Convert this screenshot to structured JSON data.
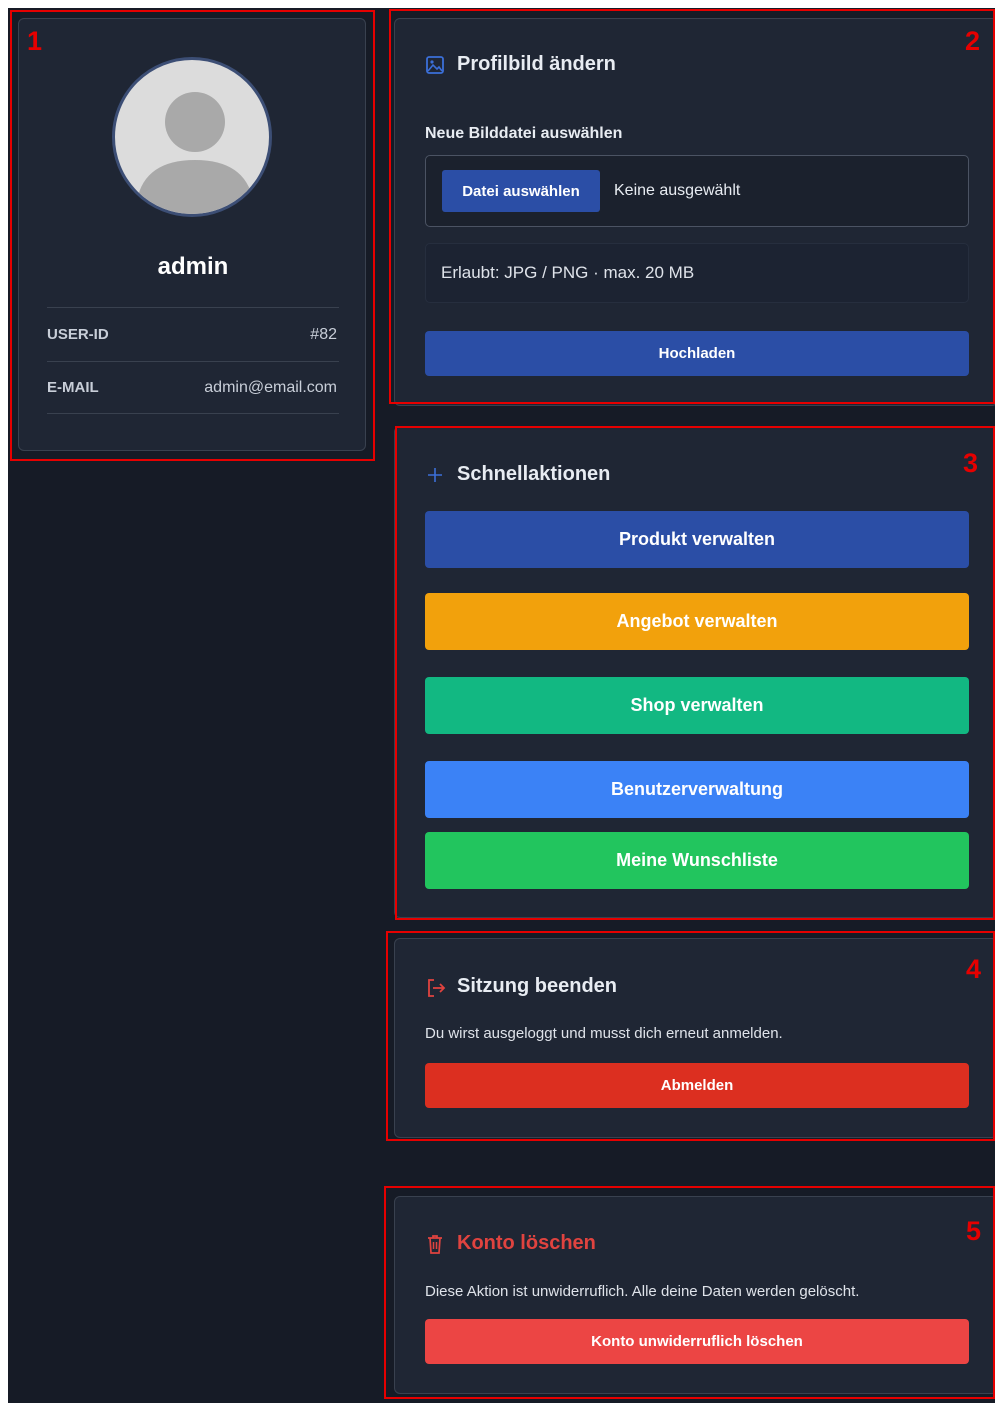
{
  "profile": {
    "username": "admin",
    "fields": [
      {
        "label": "USER-ID",
        "value": "#82"
      },
      {
        "label": "E-MAIL",
        "value": "admin@email.com"
      }
    ]
  },
  "upload": {
    "title": "Profilbild ändern",
    "file_label": "Neue Bilddatei auswählen",
    "choose_button": "Datei auswählen",
    "no_file_text": "Keine ausgewählt",
    "info": "Erlaubt: JPG / PNG · max. 20 MB",
    "submit": "Hochladen"
  },
  "quick_actions": {
    "title": "Schnellaktionen",
    "buttons": [
      {
        "label": "Produkt verwalten",
        "color": "#2b4ea6"
      },
      {
        "label": "Angebot verwalten",
        "color": "#f2a10c"
      },
      {
        "label": "Shop verwalten",
        "color": "#12b882"
      },
      {
        "label": "Benutzerverwaltung",
        "color": "#3b82f6"
      },
      {
        "label": "Meine Wunschliste",
        "color": "#22c55e"
      }
    ]
  },
  "session": {
    "title": "Sitzung beenden",
    "description": "Du wirst ausgeloggt und musst dich erneut anmelden.",
    "button": "Abmelden",
    "button_color": "#dc2f20"
  },
  "delete_account": {
    "title": "Konto löschen",
    "description": "Diese Aktion ist unwiderruflich. Alle deine Daten werden gelöscht.",
    "button": "Konto unwiderruflich löschen",
    "button_color": "#ec4544",
    "title_color": "#e0433f"
  },
  "annotations": [
    "1",
    "2",
    "3",
    "4",
    "5"
  ],
  "colors": {
    "background": "#161b26",
    "card": "#1f2634",
    "accent_blue": "#2b4ea6",
    "annotation_red": "#e60000"
  }
}
